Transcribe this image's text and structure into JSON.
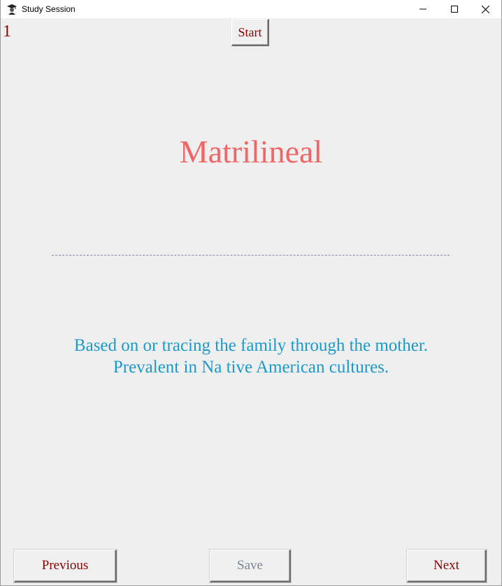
{
  "window": {
    "title": "Study Session",
    "app_icon": "graduate-icon",
    "controls": [
      "minimize-icon",
      "maximize-icon",
      "close-icon"
    ]
  },
  "session": {
    "card_number": "1",
    "start_label": "Start"
  },
  "card": {
    "term": "Matrilineal",
    "definition_line1": "Based on or tracing the family through the mother.",
    "definition_line2": "Prevalent in Na tive American cultures."
  },
  "nav": {
    "previous_label": "Previous",
    "save_label": "Save",
    "next_label": "Next"
  },
  "colors": {
    "term": "#f06565",
    "definition": "#1b9ac9",
    "accent_text": "#8b0000",
    "disabled_text": "#7a8595"
  }
}
